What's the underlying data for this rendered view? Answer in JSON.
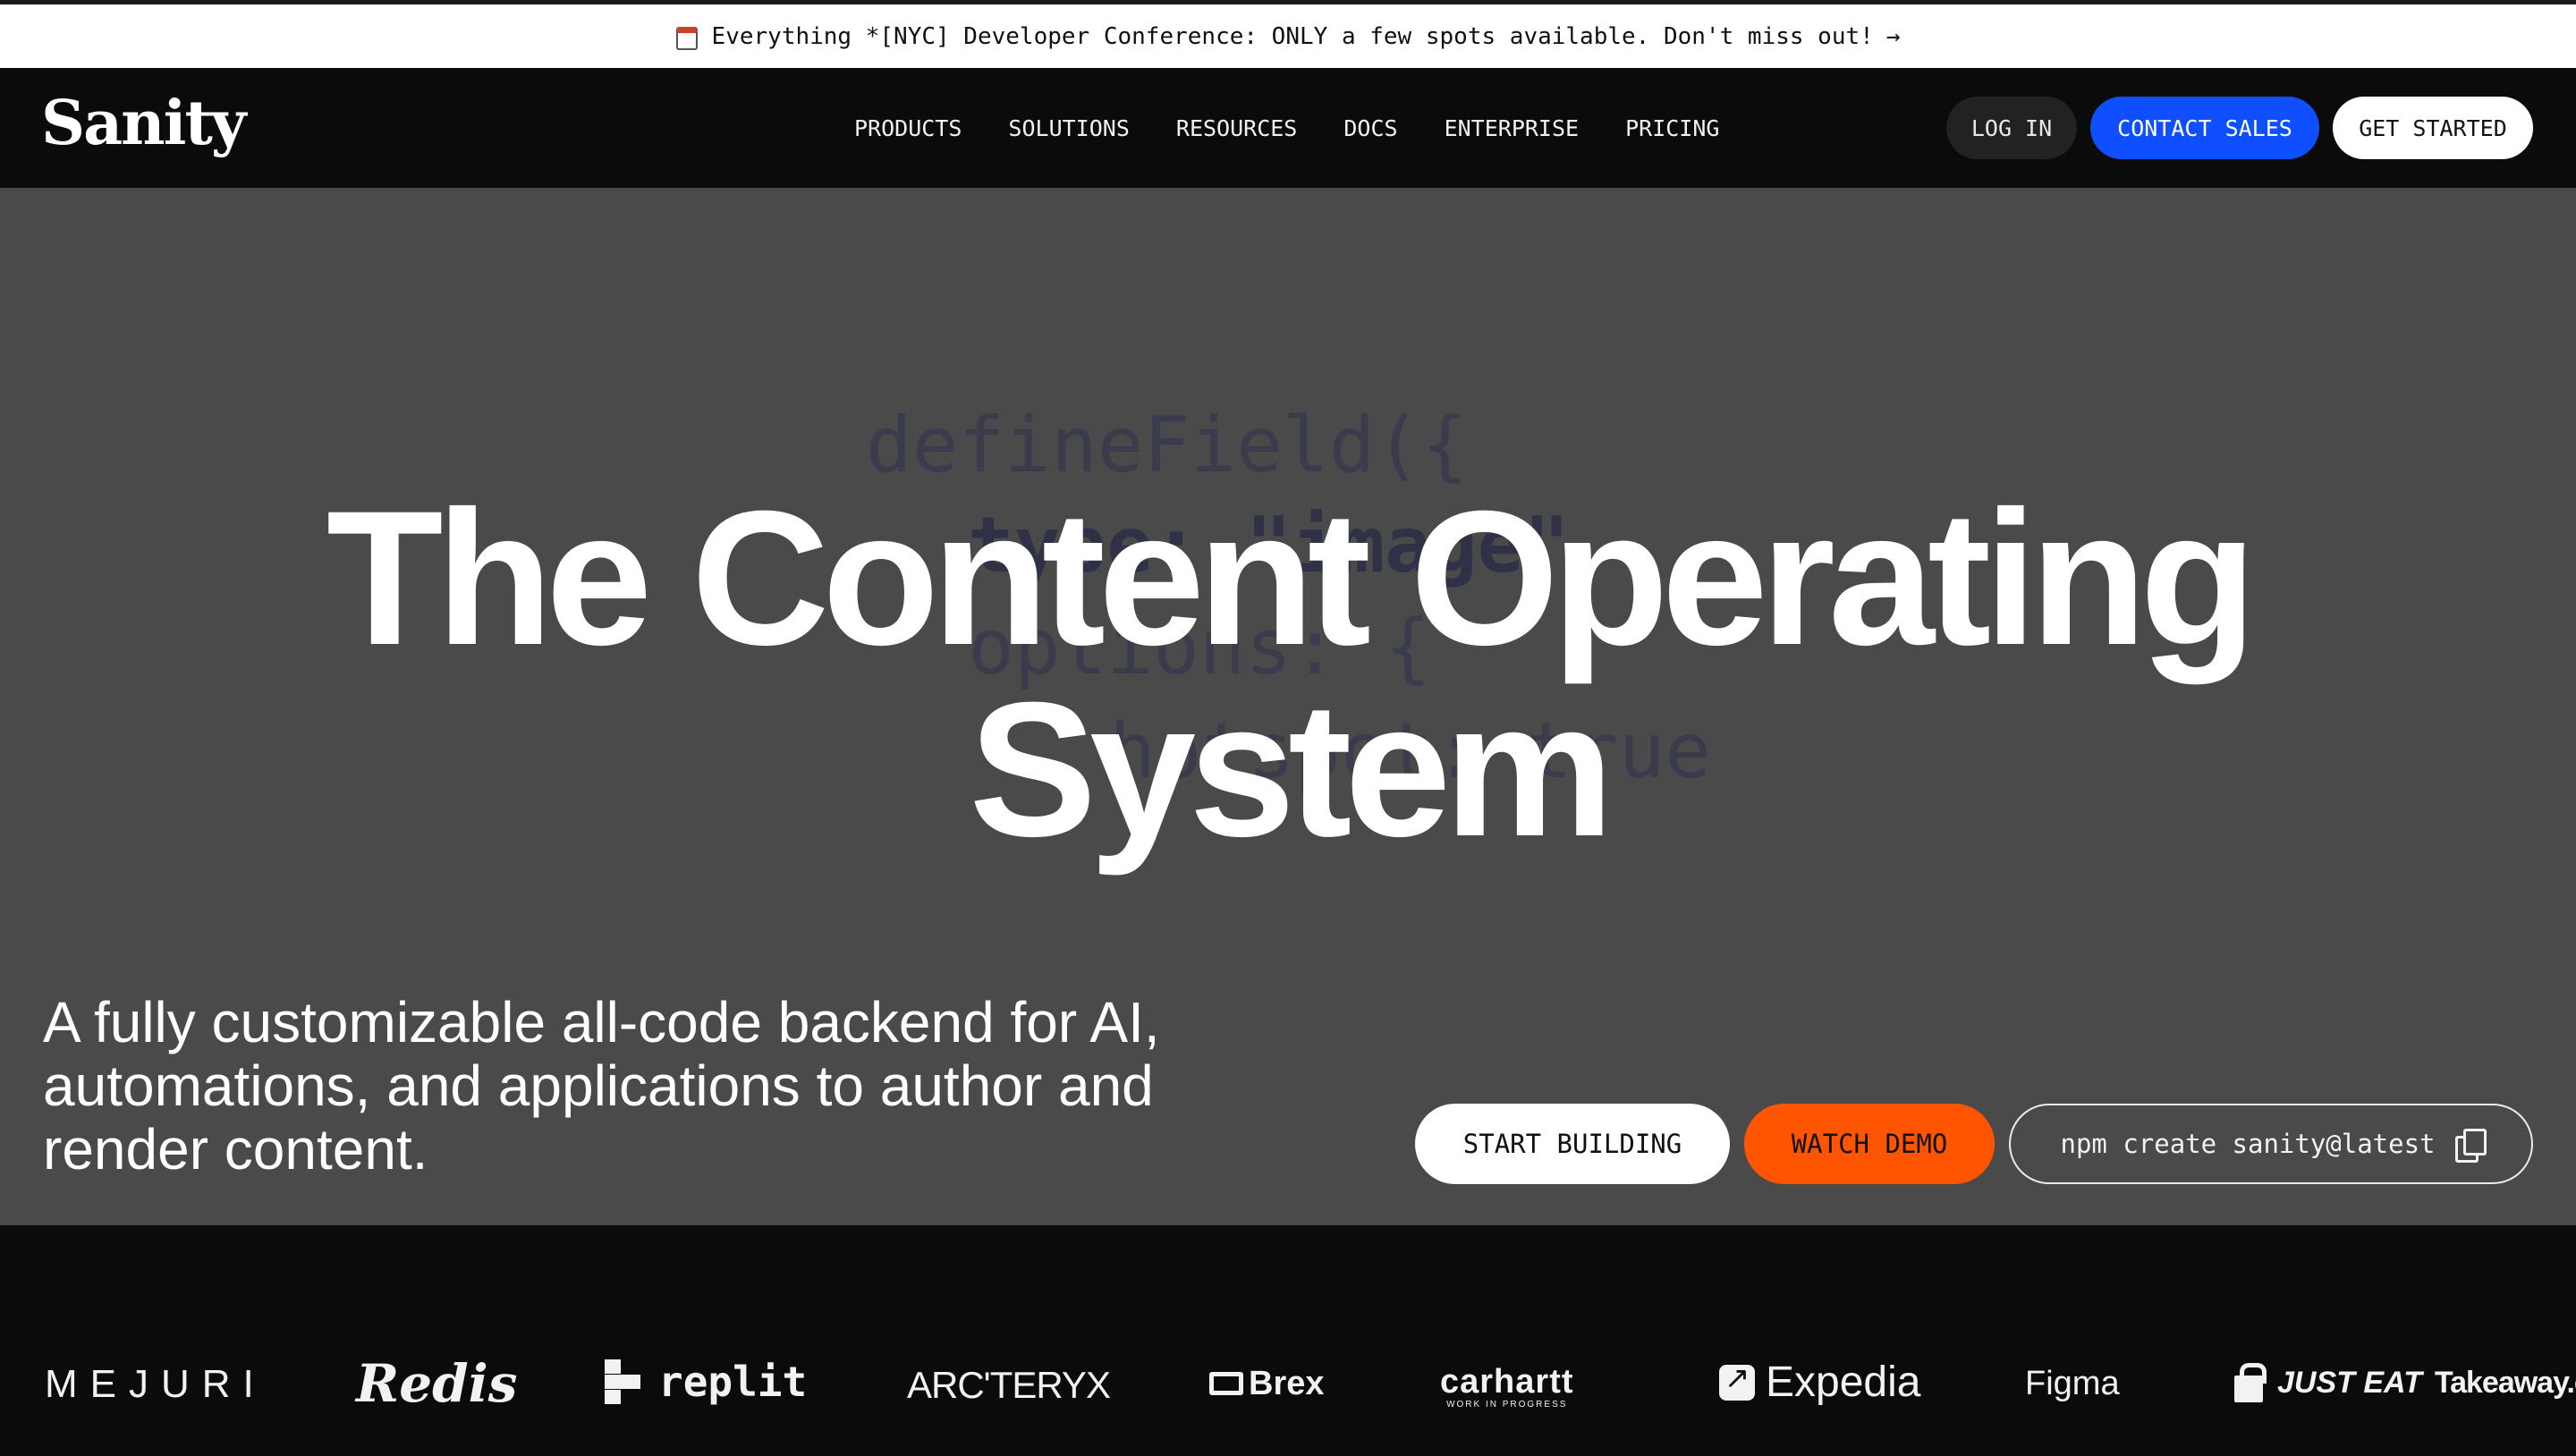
{
  "announcement": {
    "text": "Everything *[NYC] Developer Conference: ONLY a few spots available. Don't miss out!",
    "arrow": "→",
    "icon": "calendar-icon"
  },
  "header": {
    "logo": "Sanity",
    "nav": [
      "PRODUCTS",
      "SOLUTIONS",
      "RESOURCES",
      "DOCS",
      "ENTERPRISE",
      "PRICING"
    ],
    "login_label": "LOG IN",
    "contact_label": "CONTACT SALES",
    "get_started_label": "GET STARTED"
  },
  "hero": {
    "code_lines": [
      "defineField({",
      "type: \"image\"",
      "options: {",
      "hotspot: true"
    ],
    "headline": "The Content Operating System",
    "subtitle": "A fully customizable all-code backend for AI, automations, and applications to author and render content.",
    "start_building_label": "START BUILDING",
    "watch_demo_label": "WATCH DEMO",
    "npm_command": "npm create sanity@latest",
    "copy_icon": "copy-icon"
  },
  "logos": [
    "MEJURI",
    "Redis",
    "replit",
    "ARC'TERYX",
    "Brex",
    "carhartt",
    "WORK IN PROGRESS",
    "Expedia",
    "Figma",
    "JUST EAT",
    "Takeaway.com"
  ],
  "colors": {
    "accent_blue": "#0f4fff",
    "accent_orange": "#ff5500",
    "hero_bg": "#4a4a4a",
    "header_bg": "#0b0b0b"
  }
}
